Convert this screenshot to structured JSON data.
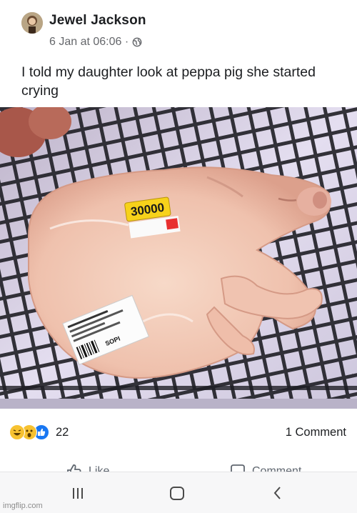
{
  "post": {
    "author": "Jewel Jackson",
    "timestamp": "6 Jan at 06:06 ·",
    "privacy_icon": "globe-icon",
    "text": "I told my daughter look at peppa pig she started crying"
  },
  "photo": {
    "price_tag": "30000",
    "barcode_label": "SOPI",
    "colors": {
      "tray": "#1e1e24",
      "pork": "#f2c9b6",
      "background": "#d8d2ea"
    }
  },
  "reactions": {
    "icons": [
      "haha-icon",
      "wow-icon",
      "like-icon"
    ],
    "count": "22",
    "comments": "1 Comment"
  },
  "actions": {
    "like_label": "Like",
    "comment_label": "Comment"
  },
  "navigation": {
    "recent_apps_icon": "recent-apps-icon",
    "home_icon": "home-icon",
    "back_icon": "back-icon"
  },
  "watermark": "imgflip.com"
}
